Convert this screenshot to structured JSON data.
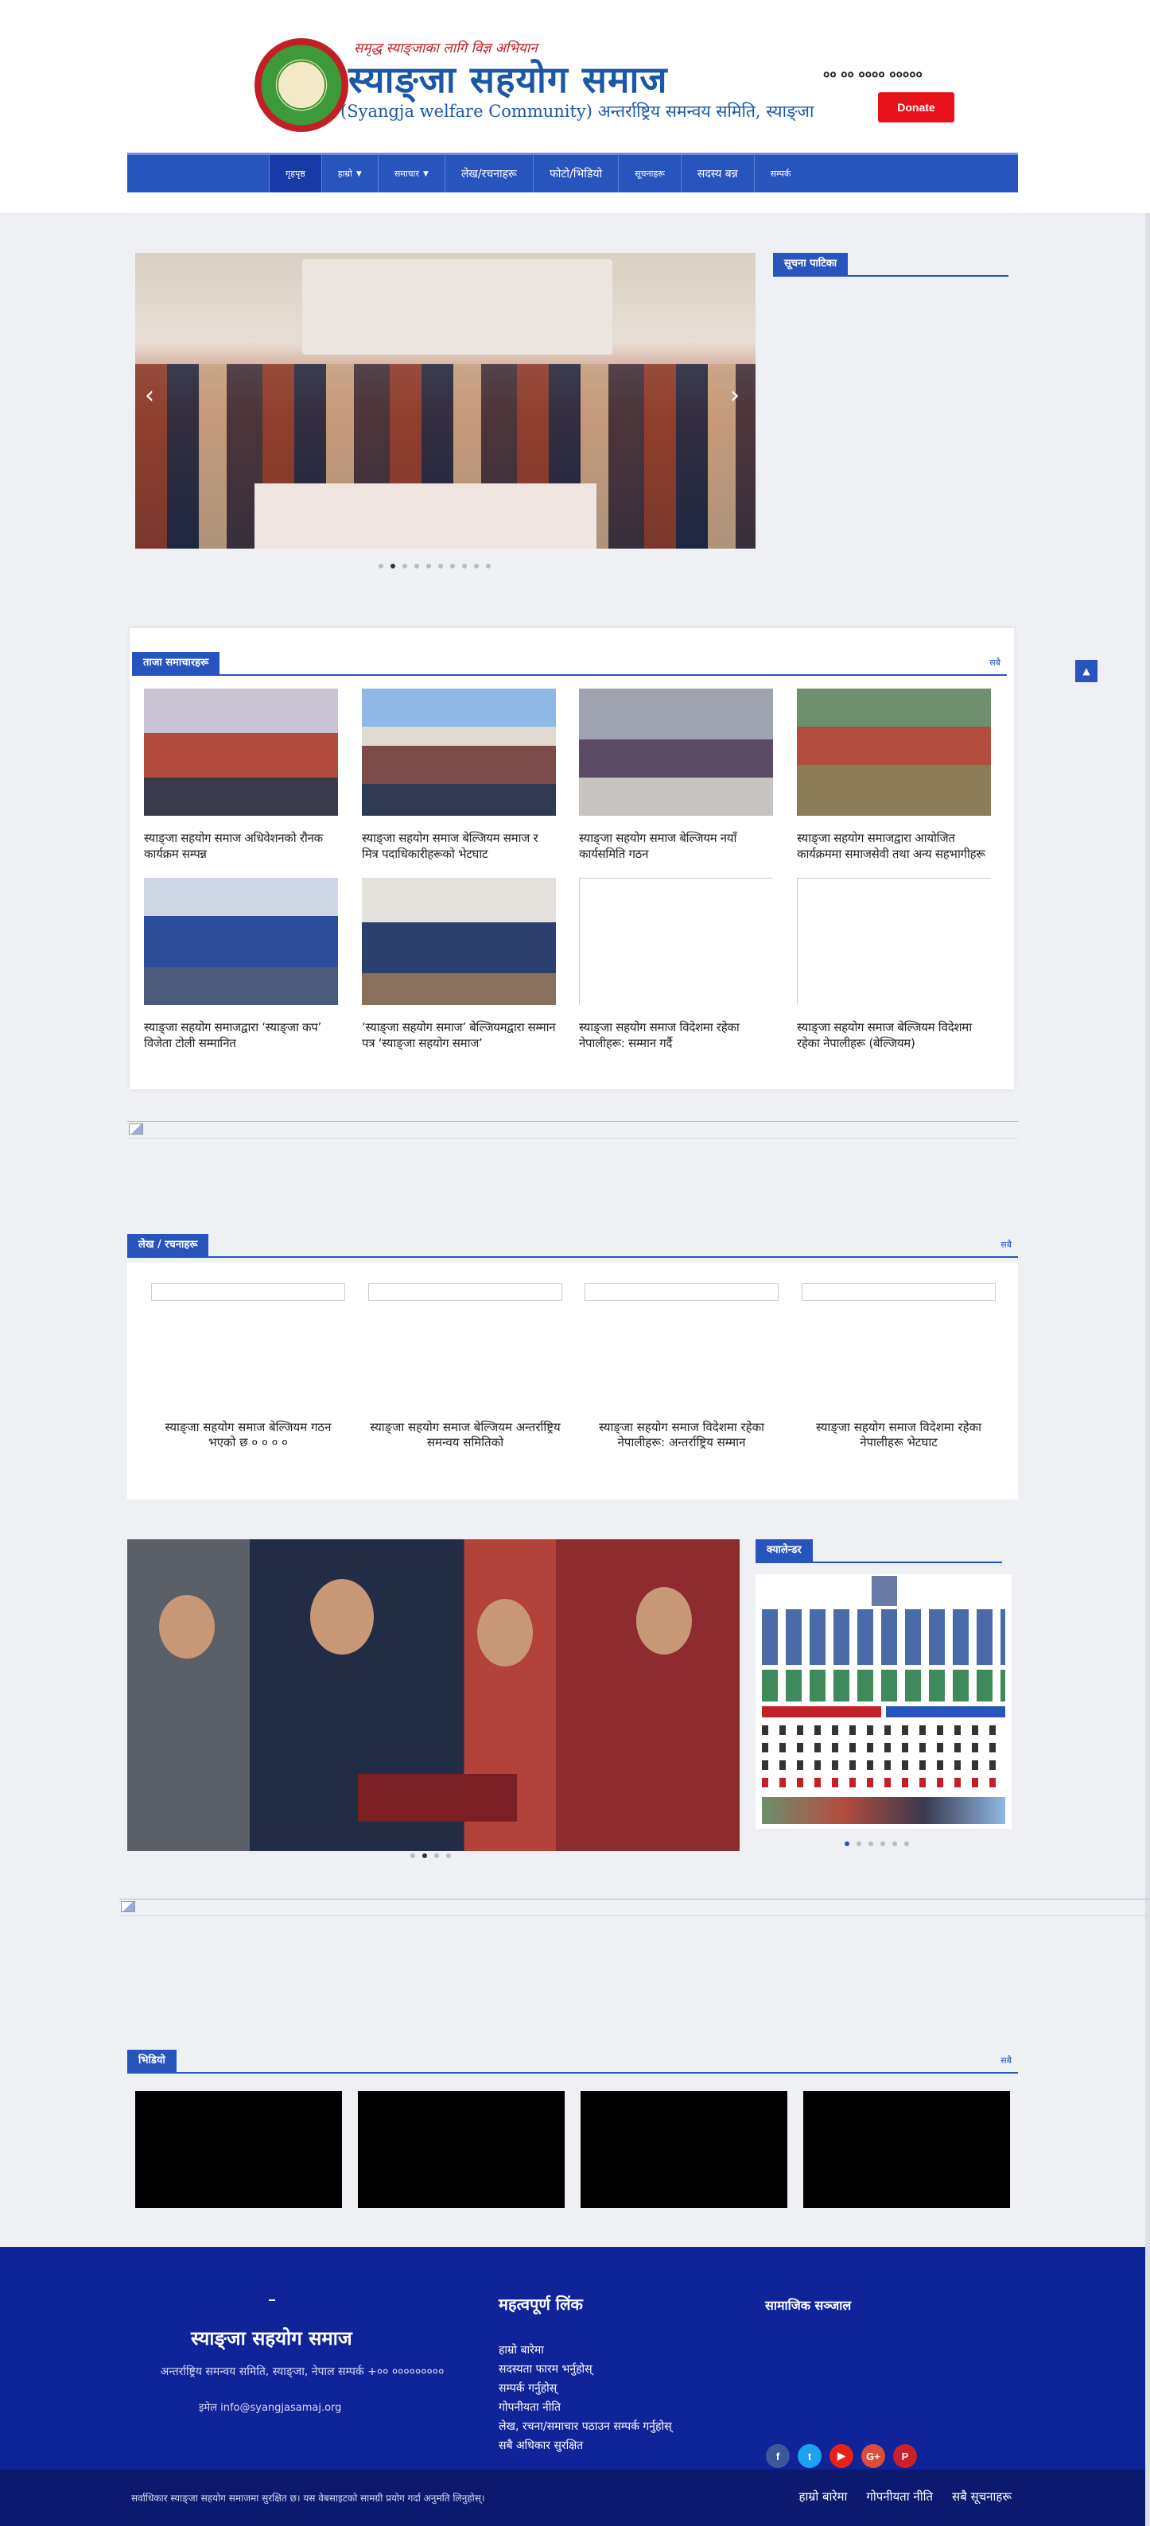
{
  "header": {
    "slogan": "समृद्ध स्याङ्जाका लागि विज्ञ अभियान",
    "title": "स्याङ्जा सहयोग समाज",
    "subtitle": "(Syangja welfare Community) अन्तर्राष्ट्रिय समन्वय समिति, स्याङ्जा",
    "phone": "०० ०० ०००० ०००००",
    "donate_label": "Donate"
  },
  "nav": {
    "items": [
      {
        "label": "गृहपृष्ठ",
        "active": true
      },
      {
        "label": "हाम्रो",
        "dropdown": true
      },
      {
        "label": "समाचार",
        "dropdown": true
      },
      {
        "label": "लेख/रचनाहरू"
      },
      {
        "label": "फोटो/भिडियो"
      },
      {
        "label": "सूचनाहरू"
      },
      {
        "label": "सदस्य बन्न"
      },
      {
        "label": "सम्पर्क"
      }
    ]
  },
  "notice": {
    "heading": "सूचना पाटिका"
  },
  "latest": {
    "heading": "ताजा समाचारहरू",
    "more": "सबै",
    "items": [
      {
        "title": "स्याङ्जा सहयोग समाज अधिवेशनको रौनक कार्यक्रम सम्पन्न"
      },
      {
        "title": "स्याङ्जा सहयोग समाज बेल्जियम समाज र मित्र पदाधिकारीहरूको भेटघाट"
      },
      {
        "title": "स्याङ्जा सहयोग समाज बेल्जियम नयाँ कार्यसमिति गठन"
      },
      {
        "title": "स्याङ्जा सहयोग समाजद्वारा आयोजित कार्यक्रममा समाजसेवी तथा अन्य सहभागीहरू"
      },
      {
        "title": "स्याङ्जा सहयोग समाजद्वारा ‘स्याङ्जा कप’ विजेता टोली सम्मानित"
      },
      {
        "title": "‘स्याङ्जा सहयोग समाज’ बेल्जियमद्वारा सम्मान पत्र ‘स्याङ्जा सहयोग समाज’"
      },
      {
        "title": "स्याङ्जा सहयोग समाज विदेशमा रहेका नेपालीहरू: सम्मान गर्दै"
      },
      {
        "title": "स्याङ्जा सहयोग समाज बेल्जियम विदेशमा रहेका नेपालीहरू (बेल्जियम)"
      }
    ]
  },
  "articles": {
    "heading": "लेख / रचनाहरू",
    "more": "सबै",
    "items": [
      {
        "title": "स्याङ्जा सहयोग समाज बेल्जियम गठन भएको छ ० ० ० ०"
      },
      {
        "title": "स्याङ्जा सहयोग समाज बेल्जियम अन्तर्राष्ट्रिय समन्वय समितिको"
      },
      {
        "title": "स्याङ्जा सहयोग समाज विदेशमा रहेका नेपालीहरू: अन्तर्राष्ट्रिय सम्मान"
      },
      {
        "title": "स्याङ्जा सहयोग समाज विदेशमा रहेका नेपालीहरू भेटघाट"
      }
    ]
  },
  "calendar": {
    "heading": "क्यालेन्डर"
  },
  "videos": {
    "heading": "भिडियो",
    "more": "सबै"
  },
  "footer": {
    "org_name": "स्याङ्जा सहयोग समाज",
    "address": "अन्तर्राष्ट्रिय समन्वय समिति, स्याङ्जा, नेपाल सम्पर्क +०० ०००००००००",
    "email": "इमेल info@syangjasamaj.org",
    "links_heading": "महत्वपूर्ण लिंक",
    "links": [
      "हाम्रो बारेमा",
      "सदस्यता फारम भर्नुहोस्",
      "सम्पर्क गर्नुहोस्",
      "गोपनीयता नीति",
      "लेख, रचना/समाचार पठाउन सम्पर्क गर्नुहोस्",
      "सबै अधिकार सुरक्षित"
    ],
    "social_heading": "सामाजिक सञ्जाल",
    "copyright": "सर्वाधिकार स्याङ्जा सहयोग समाजमा सुरक्षित छ। यस वेबसाइटको सामग्री प्रयोग गर्दा अनुमति लिनुहोस्।",
    "bottom_links": [
      "हाम्रो बारेमा",
      "गोपनीयता नीति",
      "सबै सूचनाहरू"
    ]
  },
  "colors": {
    "primary": "#2754bd",
    "footer": "#0f2499",
    "donate": "#e8101b"
  }
}
